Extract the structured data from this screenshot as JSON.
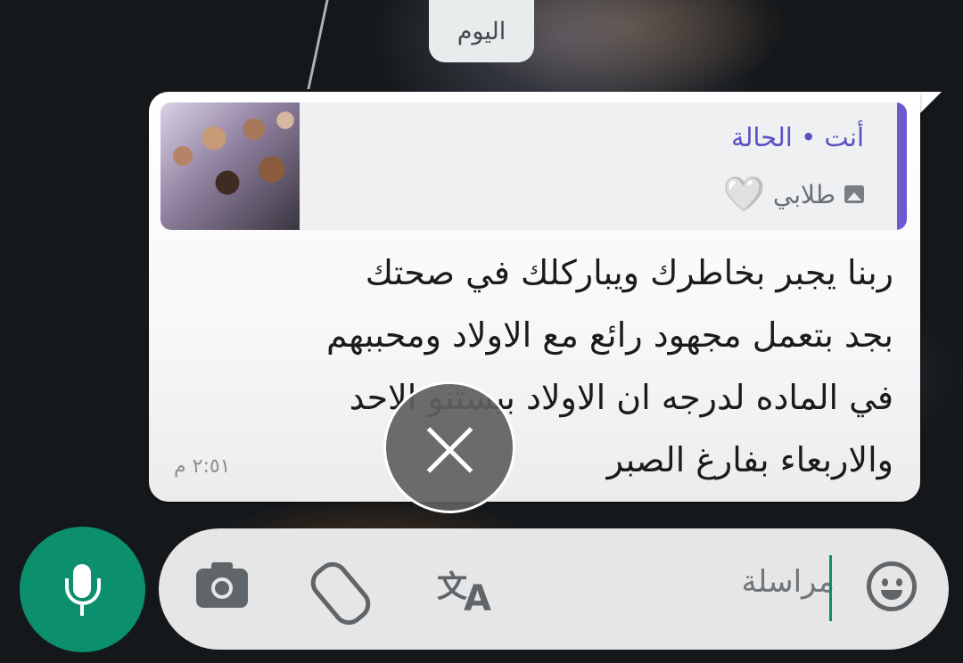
{
  "chat": {
    "date_chip": "اليوم"
  },
  "message": {
    "quote": {
      "title": "أنت • الحالة",
      "subtitle": "طلابي",
      "subtitle_emoji": "🤍",
      "media_icon": "photo-icon"
    },
    "lines": [
      "ربنا يجبر بخاطرك ويباركلك في صحتك",
      "بجد بتعمل مجهود رائع مع الاولاد ومحببهم",
      "في الماده لدرجه ان الاولاد بيستنو الاحد",
      "والاربعاء بفارغ الصبر"
    ],
    "time": "٢:٥١ م"
  },
  "composer": {
    "placeholder": "مراسلة",
    "icons": [
      "camera-icon",
      "paperclip-icon",
      "translate-icon",
      "emoji-icon",
      "microphone-icon",
      "close-icon"
    ],
    "accent_color": "#0b8f6c"
  },
  "colors": {
    "quote_accent": "#6a5acd",
    "bubble": "#ffffff"
  }
}
